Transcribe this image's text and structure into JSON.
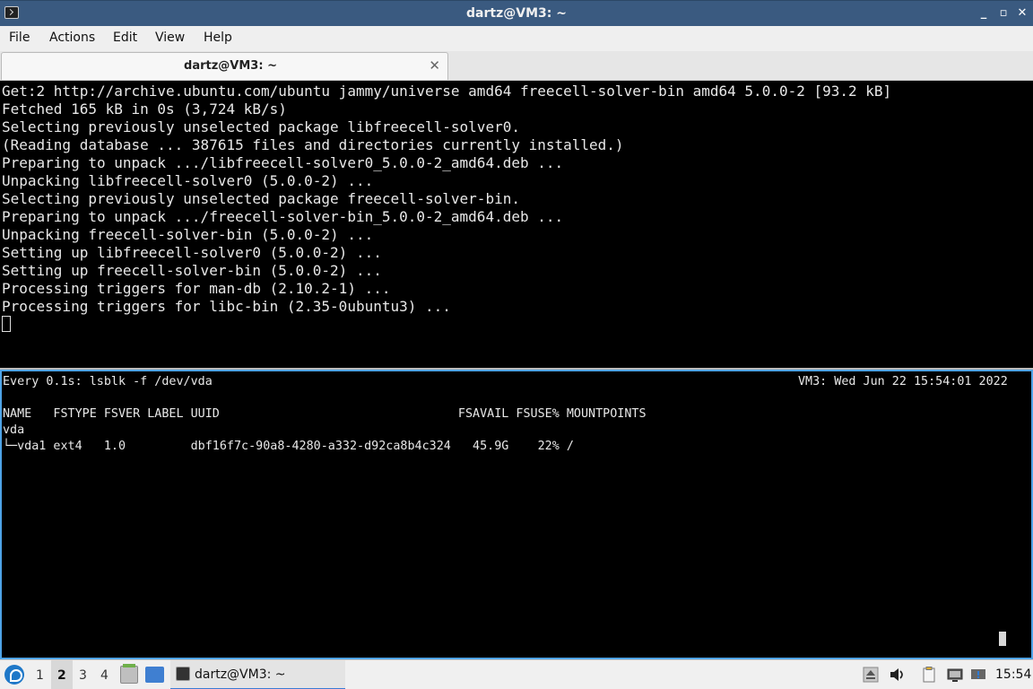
{
  "window": {
    "title": "dartz@VM3: ~",
    "buttons": {
      "minimize": "_",
      "restore": "▫",
      "close": "✕"
    }
  },
  "menu": [
    "File",
    "Actions",
    "Edit",
    "View",
    "Help"
  ],
  "tab": {
    "label": "dartz@VM3: ~",
    "close": "✕"
  },
  "terminal_top": {
    "lines": [
      "Get:2 http://archive.ubuntu.com/ubuntu jammy/universe amd64 freecell-solver-bin amd64 5.0.0-2 [93.2 kB]",
      "Fetched 165 kB in 0s (3,724 kB/s)",
      "Selecting previously unselected package libfreecell-solver0.",
      "(Reading database ... 387615 files and directories currently installed.)",
      "Preparing to unpack .../libfreecell-solver0_5.0.0-2_amd64.deb ...",
      "Unpacking libfreecell-solver0 (5.0.0-2) ...",
      "Selecting previously unselected package freecell-solver-bin.",
      "Preparing to unpack .../freecell-solver-bin_5.0.0-2_amd64.deb ...",
      "Unpacking freecell-solver-bin (5.0.0-2) ...",
      "Setting up libfreecell-solver0 (5.0.0-2) ...",
      "Setting up freecell-solver-bin (5.0.0-2) ...",
      "Processing triggers for man-db (2.10.2-1) ...",
      "Processing triggers for libc-bin (2.35-0ubuntu3) ..."
    ]
  },
  "terminal_bottom": {
    "watch_header": "Every 0.1s: lsblk -f /dev/vda",
    "watch_status": "VM3: Wed Jun 22 15:54:01 2022",
    "table_header": "NAME   FSTYPE FSVER LABEL UUID                                 FSAVAIL FSUSE% MOUNTPOINTS",
    "rows": [
      "vda",
      "└─vda1 ext4   1.0         dbf16f7c-90a8-4280-a332-d92ca8b4c324   45.9G    22% /"
    ]
  },
  "taskbar": {
    "workspaces": [
      "1",
      "2",
      "3",
      "4"
    ],
    "active_workspace": "2",
    "task_label": "dartz@VM3: ~",
    "clock": "15:54",
    "icons": [
      "start-menu-icon",
      "file-manager-icon",
      "show-desktop-icon",
      "terminal-icon",
      "update-icon",
      "volume-icon",
      "clipboard-icon",
      "network-icon",
      "notification-icon"
    ]
  },
  "colors": {
    "titlebar": "#3a5a80",
    "terminal_bg": "#000000",
    "terminal_fg": "#e8e8e8",
    "active_pane_border": "#4ea3e6",
    "taskbar_bg": "#f0f0f0"
  }
}
